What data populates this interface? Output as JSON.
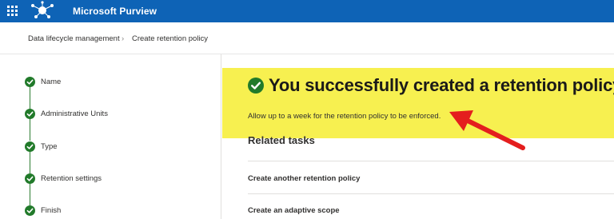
{
  "header": {
    "app_title": "Microsoft Purview",
    "waffle_icon": "app-launcher-icon",
    "logo_icon": "purview-logo-icon",
    "bar_color": "#0e63b6"
  },
  "breadcrumb": {
    "items": [
      "Data lifecycle management",
      "Create retention policy"
    ],
    "separator": "›"
  },
  "steps": [
    {
      "label": "Name",
      "status": "complete"
    },
    {
      "label": "Administrative Units",
      "status": "complete"
    },
    {
      "label": "Type",
      "status": "complete"
    },
    {
      "label": "Retention settings",
      "status": "complete"
    },
    {
      "label": "Finish",
      "status": "complete"
    }
  ],
  "success": {
    "title": "You successfully created a retention policy",
    "subtitle": "Allow up to a week for the retention policy to be enforced.",
    "highlight_color": "#f7f050",
    "check_color": "#217a2a",
    "annotation_arrow_color": "#e41e1e"
  },
  "related": {
    "heading": "Related tasks",
    "tasks": [
      "Create another retention policy",
      "Create an adaptive scope"
    ]
  }
}
